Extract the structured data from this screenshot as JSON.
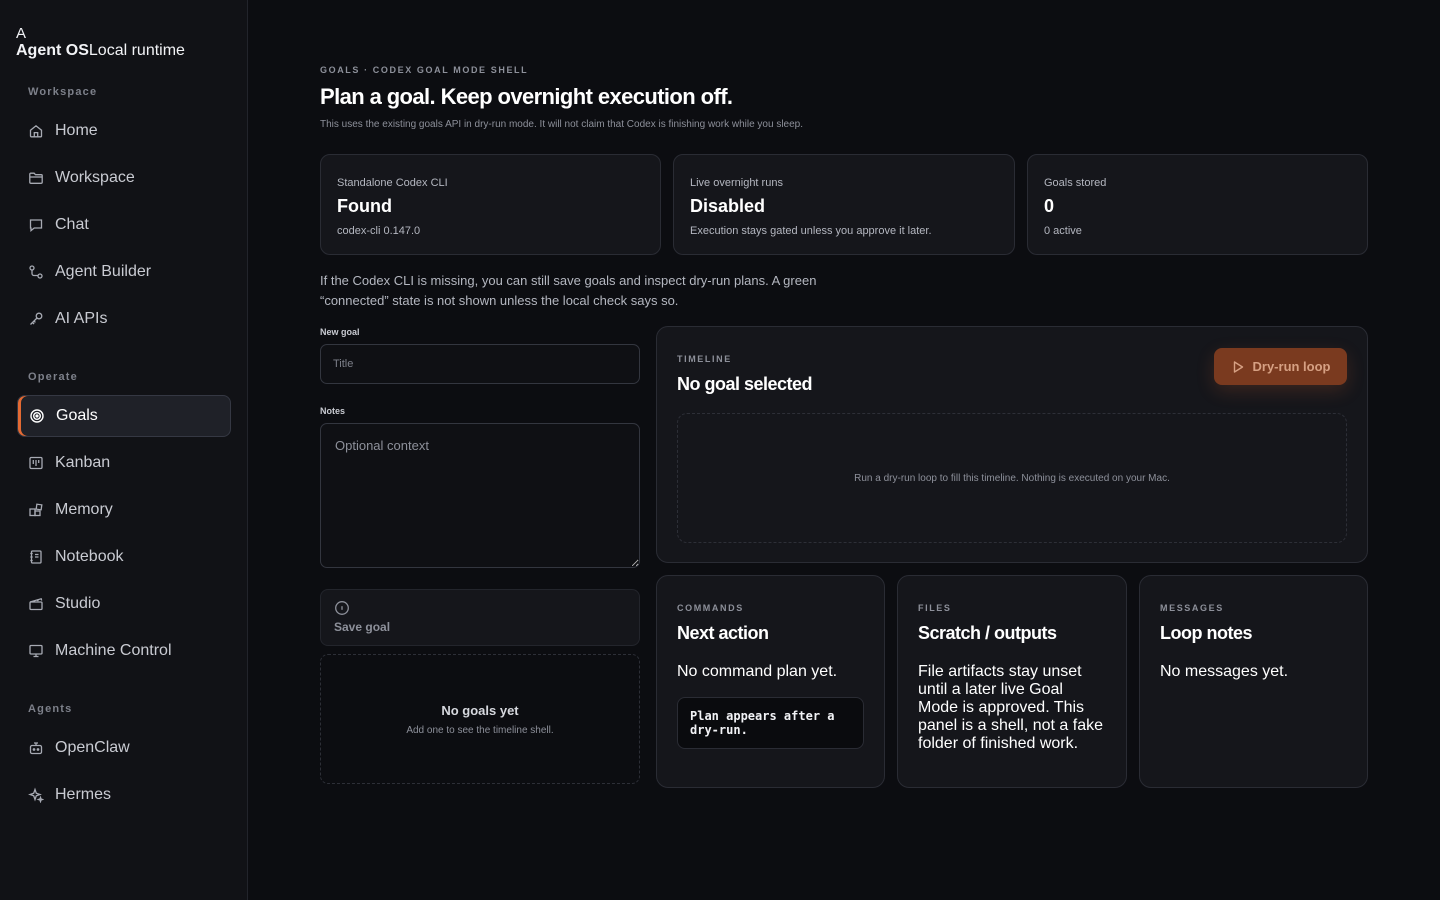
{
  "brand": {
    "mark": "A",
    "name": "Agent OS",
    "tagline": "Local runtime"
  },
  "sidebar": {
    "sections": [
      {
        "label": "Workspace"
      },
      {
        "label": "Operate"
      },
      {
        "label": "Agents"
      }
    ],
    "items": [
      {
        "label": "Home",
        "icon": "home-icon"
      },
      {
        "label": "Workspace",
        "icon": "folder-icon"
      },
      {
        "label": "Chat",
        "icon": "chat-icon"
      },
      {
        "label": "Agent Builder",
        "icon": "nodes-icon"
      },
      {
        "label": "AI APIs",
        "icon": "key-icon"
      },
      {
        "label": "Goals",
        "icon": "target-icon",
        "active": true
      },
      {
        "label": "Kanban",
        "icon": "kanban-icon"
      },
      {
        "label": "Memory",
        "icon": "memory-icon"
      },
      {
        "label": "Notebook",
        "icon": "notebook-icon"
      },
      {
        "label": "Studio",
        "icon": "studio-icon"
      },
      {
        "label": "Machine Control",
        "icon": "monitor-icon"
      },
      {
        "label": "OpenClaw",
        "icon": "robot-icon"
      },
      {
        "label": "Hermes",
        "icon": "sparkle-icon"
      }
    ]
  },
  "header": {
    "eyebrow": "GOALS · CODEX GOAL MODE SHELL",
    "title": "Plan a goal. Keep overnight execution off.",
    "subtitle": "This uses the existing goals API in dry-run mode. It will not claim that Codex is finishing work while you sleep."
  },
  "stats": [
    {
      "label": "Standalone Codex CLI",
      "value": "Found",
      "detail": "codex-cli 0.147.0"
    },
    {
      "label": "Live overnight runs",
      "value": "Disabled",
      "detail": "Execution stays gated unless you approve it later."
    },
    {
      "label": "Goals stored",
      "value": "0",
      "detail": "0 active"
    }
  ],
  "hint": "If the Codex CLI is missing, you can still save goals and inspect dry-run plans. A green “connected” state is not shown unless the local check says so.",
  "form": {
    "new_goal_label": "New goal",
    "title_placeholder": "Title",
    "notes_label": "Notes",
    "notes_placeholder": "Optional context",
    "save_label": "Save goal"
  },
  "goals_empty": {
    "title": "No goals yet",
    "subtitle": "Add one to see the timeline shell."
  },
  "timeline": {
    "eyebrow": "TIMELINE",
    "title": "No goal selected",
    "button_label": "Dry-run loop",
    "empty_text": "Run a dry-run loop to fill this timeline. Nothing is executed on your Mac."
  },
  "commands": {
    "eyebrow": "COMMANDS",
    "title": "Next action",
    "body": "No command plan yet.",
    "code": "Plan appears after a dry-run."
  },
  "files": {
    "eyebrow": "FILES",
    "title": "Scratch / outputs",
    "body": "File artifacts stay unset until a later live Goal Mode is approved. This panel is a shell, not a fake folder of finished work."
  },
  "messages": {
    "eyebrow": "MESSAGES",
    "title": "Loop notes",
    "body": "No messages yet."
  },
  "colors": {
    "accent": "#e46a33",
    "background": "#0c0d11",
    "panel": "#15161b"
  }
}
